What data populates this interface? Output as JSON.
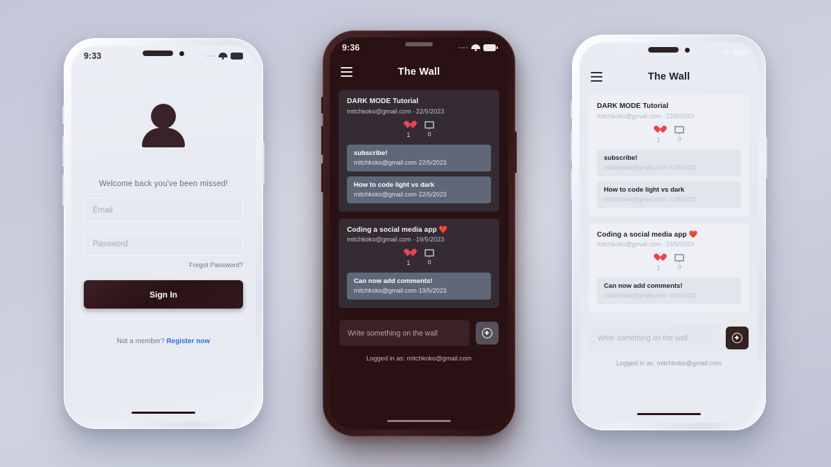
{
  "colors": {
    "accent_red": "#e8454f",
    "link_blue": "#2a6ed8",
    "dark_bg": "#2a1114",
    "dark_card": "#342b33",
    "dark_comment": "#5f6878",
    "light_bg": "#e7eaf1",
    "light_card": "#eef0f5",
    "light_comment": "#e2e5ec",
    "button_dark": "#2a1216",
    "backdrop": "#c6cad9"
  },
  "phone_login": {
    "status": {
      "time": "9:33",
      "wifi_icon": "wifi-icon",
      "battery_icon": "battery-icon",
      "signal_icon": "signal-dots-icon"
    },
    "avatar_icon": "person-avatar-icon",
    "welcome": "Welcome back you've been missed!",
    "email": {
      "placeholder": "Email",
      "value": ""
    },
    "password": {
      "placeholder": "Password",
      "value": ""
    },
    "forgot_label": "Forgot Password?",
    "signin_label": "Sign In",
    "register_prefix": "Not a member? ",
    "register_label": "Register now"
  },
  "phone_dark": {
    "theme": "dark",
    "status": {
      "time": "9:36",
      "wifi_icon": "wifi-icon",
      "battery_icon": "battery-icon",
      "signal_icon": "signal-dots-icon"
    },
    "appbar": {
      "menu_icon": "hamburger-menu-icon",
      "title": "The Wall"
    },
    "posts": [
      {
        "title": "DARK MODE Tutorial",
        "author": "mitchkoko@gmail.com",
        "separator": "·",
        "date": "22/5/2023",
        "like_icon": "heart-icon",
        "likes": "1",
        "comment_icon": "comment-bubble-icon",
        "comments_count": "0",
        "comments": [
          {
            "text": "subscribe!",
            "author": "mitchkoko@gmail.com",
            "separator": "·",
            "date": "22/5/2023"
          },
          {
            "text": "How to code light vs dark",
            "author": "mitchkoko@gmail.com",
            "separator": "·",
            "date": "22/5/2023"
          }
        ]
      },
      {
        "title": "Coding a social media app ❤️",
        "author": "mitchkoko@gmail.com",
        "separator": "·",
        "date": "19/5/2023",
        "like_icon": "heart-icon",
        "likes": "1",
        "comment_icon": "comment-bubble-icon",
        "comments_count": "0",
        "comments": [
          {
            "text": "Can now add comments!",
            "author": "mitchkoko@gmail.com",
            "separator": "·",
            "date": "19/5/2023"
          }
        ]
      }
    ],
    "composer": {
      "placeholder": "Write something on the wall",
      "value": "",
      "post_icon": "plus-circle-icon"
    },
    "logged_in_as": "Logged in as: mitchkoko@gmail.com"
  },
  "phone_light": {
    "theme": "light",
    "status": {
      "time": "9:36",
      "wifi_icon": "wifi-icon",
      "battery_icon": "battery-icon",
      "signal_icon": "signal-dots-icon"
    },
    "appbar": {
      "menu_icon": "hamburger-menu-icon",
      "title": "The Wall"
    },
    "posts": [
      {
        "title": "DARK MODE Tutorial",
        "author": "mitchkoko@gmail.com",
        "separator": "·",
        "date": "22/5/2023",
        "like_icon": "heart-icon",
        "likes": "1",
        "comment_icon": "comment-bubble-icon",
        "comments_count": "0",
        "comments": [
          {
            "text": "subscribe!",
            "author": "mitchkoko@gmail.com",
            "separator": "·",
            "date": "22/5/2023"
          },
          {
            "text": "How to code light vs dark",
            "author": "mitchkoko@gmail.com",
            "separator": "·",
            "date": "22/5/2023"
          }
        ]
      },
      {
        "title": "Coding a social media app ❤️",
        "author": "mitchkoko@gmail.com",
        "separator": "·",
        "date": "19/5/2023",
        "like_icon": "heart-icon",
        "likes": "1",
        "comment_icon": "comment-bubble-icon",
        "comments_count": "0",
        "comments": [
          {
            "text": "Can now add comments!",
            "author": "mitchkoko@gmail.com",
            "separator": "·",
            "date": "19/5/2023"
          }
        ]
      }
    ],
    "composer": {
      "placeholder": "Write something on the wall",
      "value": "",
      "post_icon": "plus-circle-icon"
    },
    "logged_in_as": "Logged in as: mitchkoko@gmail.com"
  }
}
